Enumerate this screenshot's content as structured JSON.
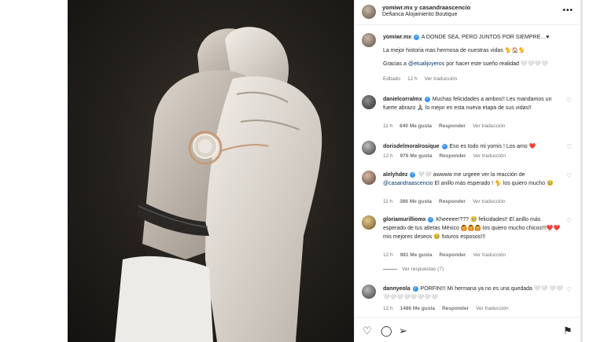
{
  "header": {
    "title": "yomiwr.mx y casandraascencio",
    "location": "Defianca Alojamiento Boutique",
    "more": "•••"
  },
  "caption": {
    "username": "yomiwr.mx",
    "text1": "A DONDE SEA, PERO JUNTOS POR SIEMPRE…♥",
    "text2": "La mejor historia mas hermosa de nuestras vidas 🐈🏠🐈",
    "text3_prefix": "Gracias a ",
    "text3_mention": "@etualijoyeros",
    "text3_suffix": " por hacer este sueño realidad 🤍🤍🤍🤍",
    "meta": {
      "edited": "Editado",
      "time": "12 h",
      "translate": "Ver traducción"
    }
  },
  "comments": [
    {
      "username": "danielcorralmx",
      "text": "Muchas felicidades a ambos!! Les mandamos un fuerte abrazo 🙏🏽 lo mejor en esta nueva etapa de sus vidas!!",
      "time": "11 h",
      "likes": "640 Me gusta",
      "reply": "Responder",
      "translate": "Ver traducción"
    },
    {
      "username": "dorisdelmoralrosique",
      "text": "Eso es todo mi yomis ! Los amo ❤️",
      "time": "12 h",
      "likes": "976 Me gusta",
      "reply": "Responder",
      "translate": "Ver traducción"
    },
    {
      "username": "alelyhdez",
      "text_prefix": "🤍🤍 awwww me urgeee ver la reacción de ",
      "mention": "@casandraascencio",
      "text_suffix": " El anillo más esperado ! 🐈 los quiero mucho 🥹",
      "time": "11 h",
      "likes": "386 Me gusta",
      "reply": "Responder",
      "translate": "Ver traducción"
    },
    {
      "username": "gloriamurilliomx",
      "text": "Kheeeee!??? 🥹 felicidades!! El anillo más esperado de tus atletas México 🙆🙆🙆 los quiero mucho chicos!!!❤️❤️ mis mejores deseos 🥹 futuros esposos!!!",
      "time": "12 h",
      "likes": "981 Me gusta",
      "reply": "Responder",
      "translate": "Ver traducción"
    },
    {
      "username": "dannyeola",
      "text": "PORFIN!!! Mi hermana ya no es una quedada 🤍🤍 🤍🤍🤍🤍🤍🤍🤍🤍🤍🤍",
      "time": "12 h",
      "likes": "1486 Me gusta",
      "reply": "Responder",
      "translate": "Ver traducción"
    }
  ],
  "replies_link": "Ver respuestas (7)",
  "actions": {
    "like": "♡",
    "comment": "◯",
    "share": "➢",
    "save": "⚑"
  },
  "colors": {
    "verified": "#3897f0",
    "link": "#00376b",
    "muted": "#737373"
  }
}
